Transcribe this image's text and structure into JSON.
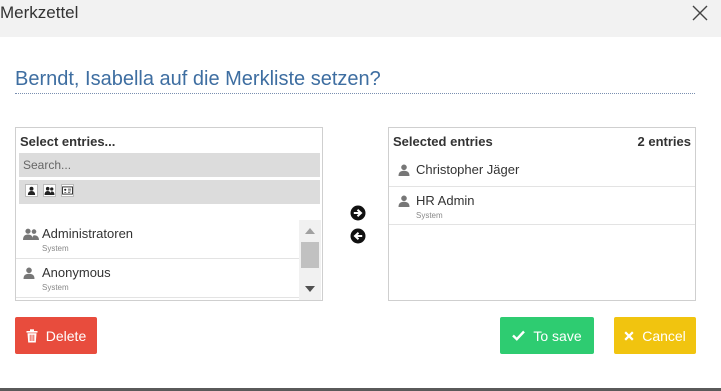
{
  "dialog": {
    "title": "Merkzettel",
    "question": "Berndt, Isabella auf die Merkliste setzen?"
  },
  "left_panel": {
    "heading": "Select entries...",
    "search_placeholder": "Search...",
    "filter_icons": [
      "user-icon",
      "users-icon",
      "id-card-icon"
    ],
    "items": [
      {
        "icon": "users-icon",
        "name": "Administratoren",
        "sub": "System"
      },
      {
        "icon": "user-icon",
        "name": "Anonymous",
        "sub": "System"
      }
    ]
  },
  "right_panel": {
    "heading": "Selected entries",
    "count": "2 entries",
    "items": [
      {
        "icon": "user-icon",
        "name": "Christopher Jäger",
        "sub": ""
      },
      {
        "icon": "user-icon",
        "name": "HR Admin",
        "sub": "System"
      }
    ]
  },
  "move_buttons": {
    "add_icon": "arrow-right-circle-icon",
    "remove_icon": "arrow-left-circle-icon"
  },
  "buttons": {
    "delete": "Delete",
    "save": "To save",
    "cancel": "Cancel"
  },
  "colors": {
    "question": "#3e6ea1",
    "delete": "#e84c3d",
    "save": "#2ecc71",
    "cancel": "#f1c40f"
  }
}
